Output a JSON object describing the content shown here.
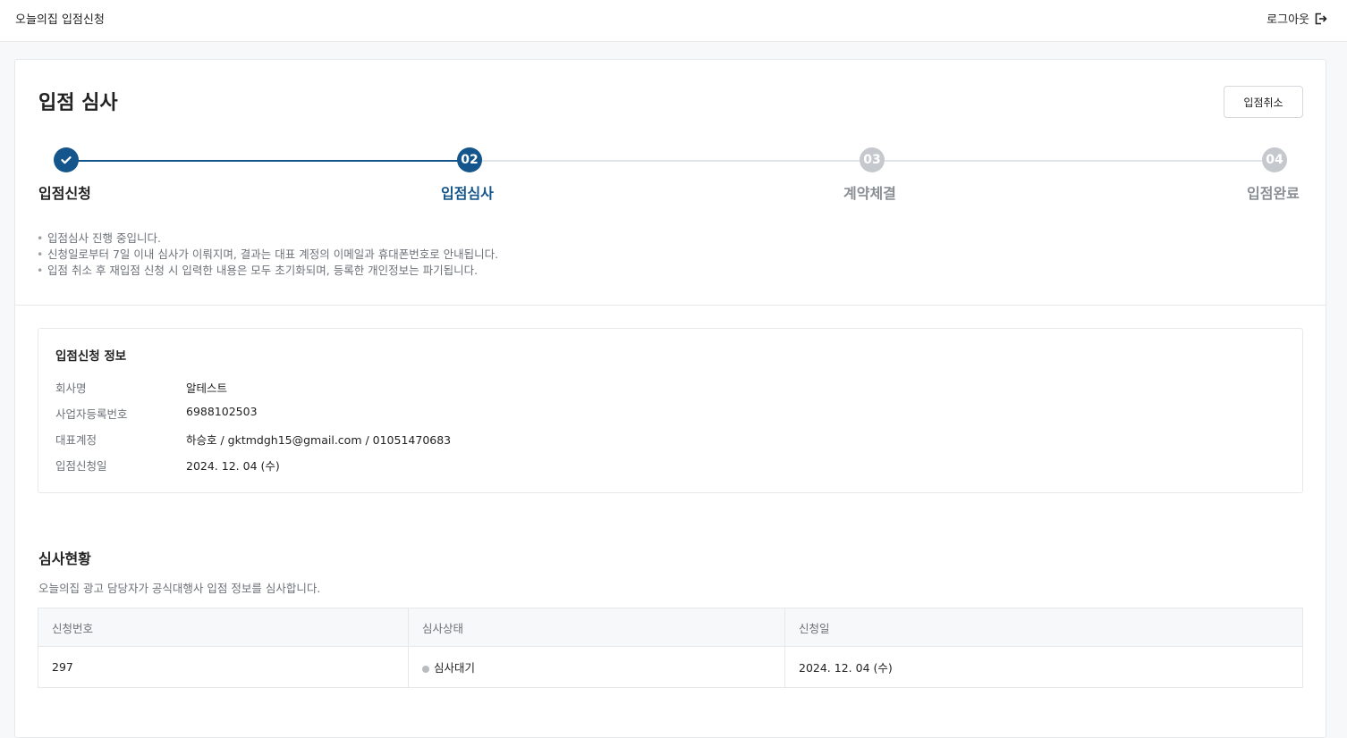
{
  "header": {
    "brand": "오늘의집 입점신청",
    "logout_label": "로그아웃"
  },
  "page": {
    "title": "입점 심사",
    "cancel_label": "입점취소"
  },
  "stepper": {
    "steps": [
      {
        "number": "",
        "label": "입점신청",
        "state": "completed"
      },
      {
        "number": "02",
        "label": "입점심사",
        "state": "active"
      },
      {
        "number": "03",
        "label": "계약체결",
        "state": "pending"
      },
      {
        "number": "04",
        "label": "입점완료",
        "state": "pending"
      }
    ]
  },
  "notes": [
    "입점심사 진행 중입니다.",
    "신청일로부터 7일 이내 심사가 이뤄지며, 결과는 대표 계정의 이메일과 휴대폰번호로 안내됩니다.",
    "입점 취소 후 재입점 신청 시 입력한 내용은 모두 초기화되며, 등록한 개인정보는 파기됩니다."
  ],
  "application_info": {
    "title": "입점신청 정보",
    "rows": [
      {
        "key": "회사명",
        "value": "알테스트"
      },
      {
        "key": "사업자등록번호",
        "value": "6988102503"
      },
      {
        "key": "대표계정",
        "value": "하승호 / gktmdgh15@gmail.com / 01051470683"
      },
      {
        "key": "입점신청일",
        "value": "2024. 12. 04 (수)"
      }
    ]
  },
  "review_status": {
    "title": "심사현황",
    "description": "오늘의집 광고 담당자가 공식대행사 입점 정보를 심사합니다.",
    "columns": [
      "신청번호",
      "심사상태",
      "신청일"
    ],
    "rows": [
      {
        "id": "297",
        "status": "심사대기",
        "date": "2024. 12. 04 (수)"
      }
    ]
  },
  "colors": {
    "accent": "#14568c",
    "pending": "#c5c9cd",
    "muted_text": "#6d7278"
  }
}
